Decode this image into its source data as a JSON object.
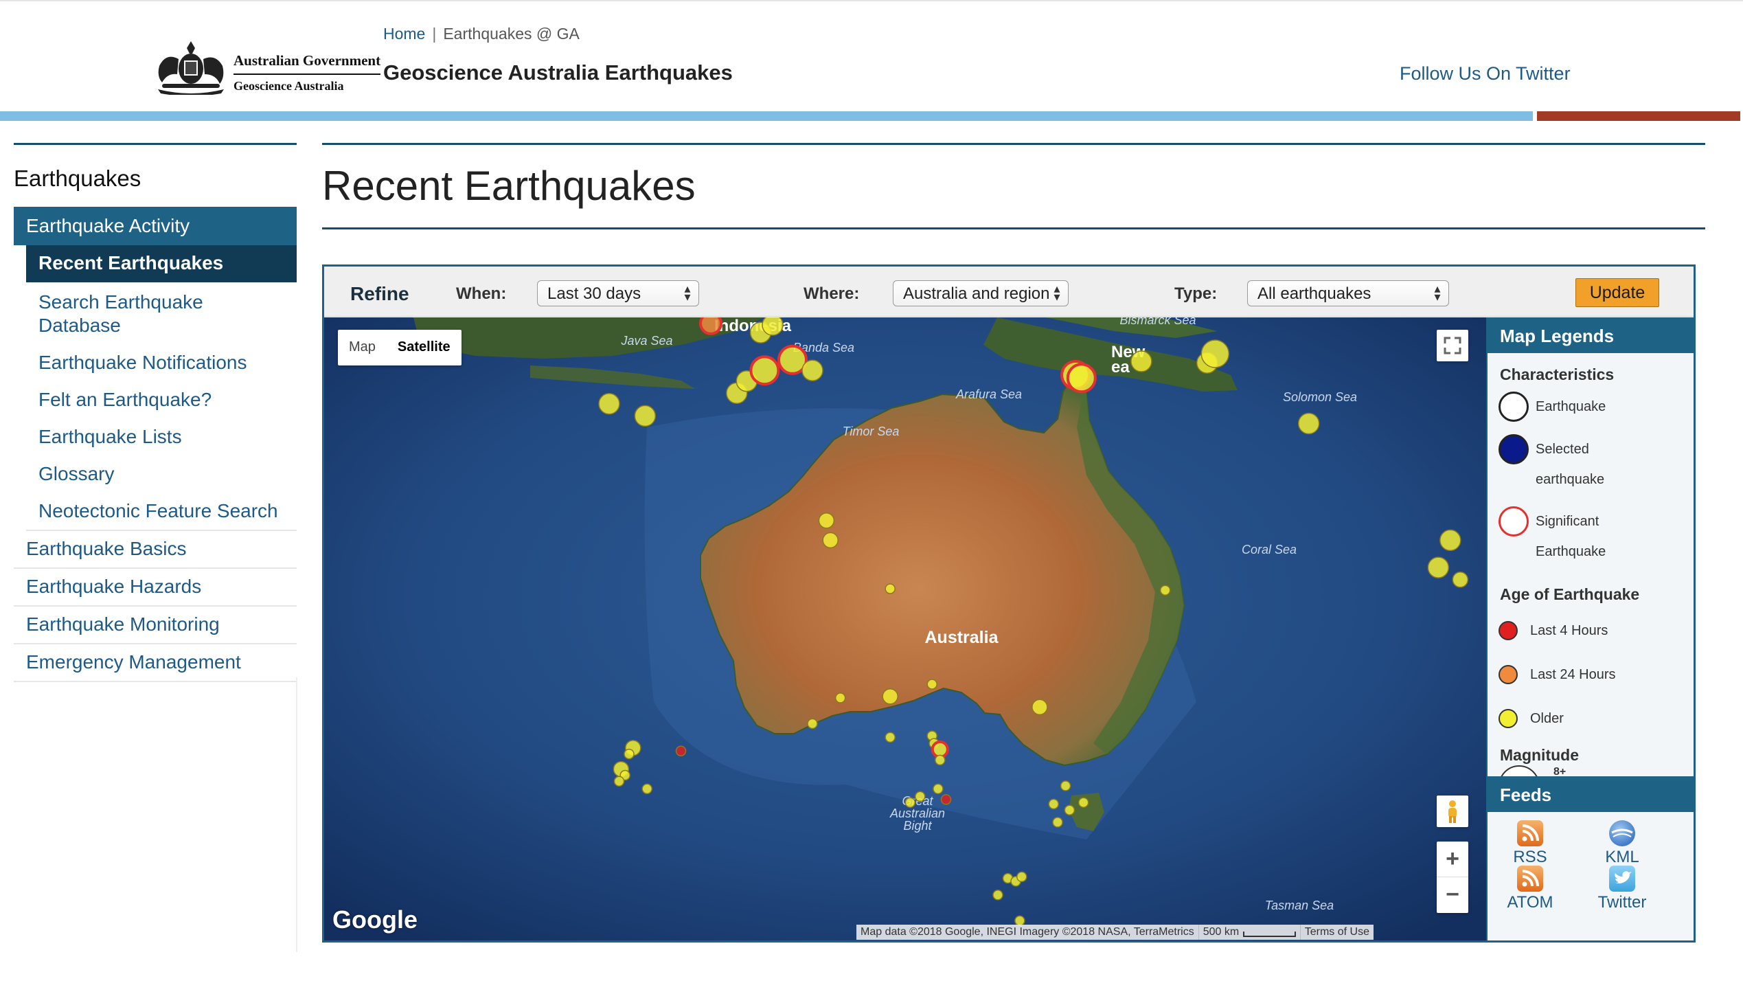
{
  "header": {
    "gov_line1": "Australian Government",
    "gov_line2": "Geoscience Australia",
    "breadcrumb": {
      "home": "Home",
      "separator": "|",
      "current": "Earthquakes @ GA"
    },
    "site_title": "Geoscience Australia Earthquakes",
    "twitter_link": "Follow Us On Twitter"
  },
  "sidebar": {
    "title": "Earthquakes",
    "section_active": "Earthquake Activity",
    "sub_items": [
      "Recent Earthquakes",
      "Search Earthquake Database",
      "Earthquake Notifications",
      "Felt an Earthquake?",
      "Earthquake Lists",
      "Glossary",
      "Neotectonic Feature Search"
    ],
    "top_items": [
      "Earthquake Basics",
      "Earthquake Hazards",
      "Earthquake Monitoring",
      "Emergency Management"
    ]
  },
  "main": {
    "title": "Recent Earthquakes"
  },
  "refine": {
    "label": "Refine",
    "when_label": "When:",
    "when_value": "Last 30 days",
    "where_label": "Where:",
    "where_value": "Australia and region",
    "type_label": "Type:",
    "type_value": "All earthquakes",
    "update_label": "Update"
  },
  "map": {
    "type_map": "Map",
    "type_satellite": "Satellite",
    "selected_type": "Satellite",
    "labels": {
      "indonesia": "Indonesia",
      "java_sea": "Java Sea",
      "banda_sea": "Banda Sea",
      "arafura_sea": "Arafura Sea",
      "timor_sea": "Timor Sea",
      "bismarck_sea": "Bismarck Sea",
      "new_guinea_1": "New",
      "new_guinea_2": "ea",
      "solomon_sea": "Solomon Sea",
      "coral_sea": "Coral Sea",
      "australia": "Australia",
      "great_australian_bight_1": "Great",
      "great_australian_bight_2": "Australian",
      "great_australian_bight_3": "Bight",
      "tasman_sea": "Tasman Sea"
    },
    "google": "Google",
    "attribution": "Map data ©2018 Google, INEGI Imagery ©2018 NASA, TerraMetrics",
    "scale": "500 km",
    "terms": "Terms of Use",
    "zoom_in": "+",
    "zoom_out": "−",
    "earthquakes": [
      {
        "lon": 106.9,
        "lat": -2.0,
        "age": "older",
        "size": "small",
        "significant": false
      },
      {
        "lon": 118.3,
        "lat": -5.1,
        "age": "older",
        "size": "medium",
        "significant": false
      },
      {
        "lon": 120.1,
        "lat": -5.9,
        "age": "older",
        "size": "medium",
        "significant": false
      },
      {
        "lon": 124.7,
        "lat": -4.4,
        "age": "older",
        "size": "medium",
        "significant": false
      },
      {
        "lon": 125.2,
        "lat": -3.6,
        "age": "older",
        "size": "medium",
        "significant": false
      },
      {
        "lon": 126.1,
        "lat": -2.9,
        "age": "older",
        "size": "large",
        "significant": true
      },
      {
        "lon": 127.5,
        "lat": -2.2,
        "age": "older",
        "size": "large",
        "significant": true
      },
      {
        "lon": 128.5,
        "lat": -2.9,
        "age": "older",
        "size": "medium",
        "significant": false
      },
      {
        "lon": 125.9,
        "lat": -0.4,
        "age": "older",
        "size": "medium",
        "significant": false
      },
      {
        "lon": 126.5,
        "lat": 0.1,
        "age": "older",
        "size": "medium",
        "significant": false
      },
      {
        "lon": 123.4,
        "lat": 0.2,
        "age": "last24",
        "size": "medium",
        "significant": true
      },
      {
        "lon": 141.7,
        "lat": -3.2,
        "age": "older",
        "size": "large",
        "significant": true
      },
      {
        "lon": 142.0,
        "lat": -3.4,
        "age": "older",
        "size": "large",
        "significant": true
      },
      {
        "lon": 145.0,
        "lat": -2.3,
        "age": "older",
        "size": "medium",
        "significant": false
      },
      {
        "lon": 148.3,
        "lat": -2.4,
        "age": "older",
        "size": "medium",
        "significant": false
      },
      {
        "lon": 148.7,
        "lat": -1.8,
        "age": "older",
        "size": "large",
        "significant": false
      },
      {
        "lon": 153.4,
        "lat": -6.4,
        "age": "older",
        "size": "medium",
        "significant": false
      },
      {
        "lon": 160.5,
        "lat": -14.1,
        "age": "older",
        "size": "medium",
        "significant": false
      },
      {
        "lon": 159.9,
        "lat": -15.9,
        "age": "older",
        "size": "medium",
        "significant": false
      },
      {
        "lon": 161.0,
        "lat": -16.7,
        "age": "older",
        "size": "small",
        "significant": false
      },
      {
        "lon": 129.2,
        "lat": -12.8,
        "age": "older",
        "size": "small",
        "significant": false
      },
      {
        "lon": 129.4,
        "lat": -14.1,
        "age": "older",
        "size": "small",
        "significant": false
      },
      {
        "lon": 132.4,
        "lat": -17.3,
        "age": "older",
        "size": "tiny",
        "significant": false
      },
      {
        "lon": 146.2,
        "lat": -17.4,
        "age": "older",
        "size": "tiny",
        "significant": false
      },
      {
        "lon": 134.5,
        "lat": -23.6,
        "age": "older",
        "size": "tiny",
        "significant": false
      },
      {
        "lon": 132.4,
        "lat": -24.4,
        "age": "older",
        "size": "small",
        "significant": false
      },
      {
        "lon": 129.9,
        "lat": -24.5,
        "age": "older",
        "size": "tiny",
        "significant": false
      },
      {
        "lon": 128.5,
        "lat": -26.2,
        "age": "older",
        "size": "tiny",
        "significant": false
      },
      {
        "lon": 132.4,
        "lat": -27.1,
        "age": "older",
        "size": "tiny",
        "significant": false
      },
      {
        "lon": 134.5,
        "lat": -27.0,
        "age": "older",
        "size": "tiny",
        "significant": false
      },
      {
        "lon": 134.6,
        "lat": -27.5,
        "age": "older",
        "size": "tiny",
        "significant": false
      },
      {
        "lon": 134.9,
        "lat": -27.9,
        "age": "older",
        "size": "small",
        "significant": true
      },
      {
        "lon": 134.9,
        "lat": -28.6,
        "age": "older",
        "size": "tiny",
        "significant": false
      },
      {
        "lon": 139.9,
        "lat": -25.1,
        "age": "older",
        "size": "small",
        "significant": false
      },
      {
        "lon": 119.5,
        "lat": -27.8,
        "age": "older",
        "size": "small",
        "significant": false
      },
      {
        "lon": 119.3,
        "lat": -28.2,
        "age": "older",
        "size": "tiny",
        "significant": false
      },
      {
        "lon": 118.9,
        "lat": -29.2,
        "age": "older",
        "size": "small",
        "significant": false
      },
      {
        "lon": 119.1,
        "lat": -29.6,
        "age": "older",
        "size": "tiny",
        "significant": false
      },
      {
        "lon": 118.8,
        "lat": -30.0,
        "age": "older",
        "size": "tiny",
        "significant": false
      },
      {
        "lon": 120.2,
        "lat": -30.5,
        "age": "older",
        "size": "tiny",
        "significant": false
      },
      {
        "lon": 121.9,
        "lat": -28.0,
        "age": "last4",
        "size": "tiny",
        "significant": false
      },
      {
        "lon": 133.9,
        "lat": -31.0,
        "age": "older",
        "size": "tiny",
        "significant": false
      },
      {
        "lon": 133.4,
        "lat": -31.4,
        "age": "older",
        "size": "tiny",
        "significant": false
      },
      {
        "lon": 134.8,
        "lat": -30.5,
        "age": "older",
        "size": "tiny",
        "significant": false
      },
      {
        "lon": 135.2,
        "lat": -31.2,
        "age": "last4",
        "size": "tiny",
        "significant": false
      },
      {
        "lon": 141.2,
        "lat": -30.3,
        "age": "older",
        "size": "tiny",
        "significant": false
      },
      {
        "lon": 140.6,
        "lat": -31.5,
        "age": "older",
        "size": "tiny",
        "significant": false
      },
      {
        "lon": 141.4,
        "lat": -31.9,
        "age": "older",
        "size": "tiny",
        "significant": false
      },
      {
        "lon": 142.1,
        "lat": -31.4,
        "age": "older",
        "size": "tiny",
        "significant": false
      },
      {
        "lon": 140.8,
        "lat": -32.7,
        "age": "older",
        "size": "tiny",
        "significant": false
      },
      {
        "lon": 138.3,
        "lat": -36.4,
        "age": "older",
        "size": "tiny",
        "significant": false
      },
      {
        "lon": 138.7,
        "lat": -36.6,
        "age": "older",
        "size": "tiny",
        "significant": false
      },
      {
        "lon": 139.0,
        "lat": -36.3,
        "age": "older",
        "size": "tiny",
        "significant": false
      },
      {
        "lon": 137.8,
        "lat": -37.5,
        "age": "older",
        "size": "tiny",
        "significant": false
      },
      {
        "lon": 138.9,
        "lat": -39.2,
        "age": "older",
        "size": "tiny",
        "significant": false
      }
    ]
  },
  "legend": {
    "title": "Map Legends",
    "characteristics": "Characteristics",
    "earthquake": "Earthquake",
    "selected_1": "Selected",
    "selected_2": "earthquake",
    "significant_1": "Significant",
    "significant_2": "Earthquake",
    "age_title": "Age of Earthquake",
    "last4": "Last 4 Hours",
    "last24": "Last 24 Hours",
    "older": "Older",
    "magnitude": "Magnitude",
    "magnitude_partial": "8+",
    "colors": {
      "last4": "#e02020",
      "last24": "#f08a3c",
      "older": "#f2ee32",
      "selected": "#0a1a8a",
      "significant": "#e53030"
    }
  },
  "feeds": {
    "title": "Feeds",
    "rss": "RSS",
    "kml": "KML",
    "atom": "ATOM",
    "twitter": "Twitter"
  },
  "colors": {
    "accent_blue": "#1e6386",
    "nav_dark": "#113a54",
    "link": "#1d5a88",
    "header_bar_blue": "#7fbde2",
    "header_bar_red": "#a23a26",
    "update_button": "#f1a12a"
  }
}
